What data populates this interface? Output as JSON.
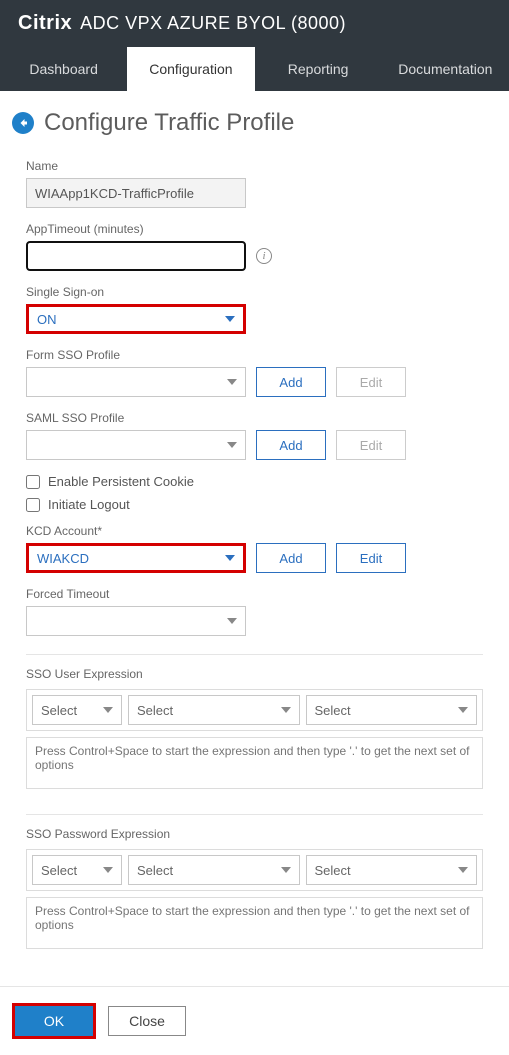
{
  "header": {
    "brand": "Citrix",
    "product": "ADC VPX AZURE BYOL (8000)"
  },
  "tabs": [
    "Dashboard",
    "Configuration",
    "Reporting",
    "Documentation"
  ],
  "active_tab_index": 1,
  "page": {
    "title": "Configure Traffic Profile"
  },
  "form": {
    "name": {
      "label": "Name",
      "value": "WIAApp1KCD-TrafficProfile"
    },
    "app_timeout": {
      "label": "AppTimeout (minutes)",
      "value": ""
    },
    "sso": {
      "label": "Single Sign-on",
      "value": "ON"
    },
    "form_sso": {
      "label": "Form SSO Profile",
      "value": "",
      "add": "Add",
      "edit": "Edit"
    },
    "saml_sso": {
      "label": "SAML SSO Profile",
      "value": "",
      "add": "Add",
      "edit": "Edit"
    },
    "persistent_cookie": {
      "label": "Enable Persistent Cookie",
      "checked": false
    },
    "initiate_logout": {
      "label": "Initiate Logout",
      "checked": false
    },
    "kcd": {
      "label": "KCD Account*",
      "value": "WIAKCD",
      "add": "Add",
      "edit": "Edit"
    },
    "forced_timeout": {
      "label": "Forced Timeout",
      "value": ""
    },
    "sso_user_expr": {
      "label": "SSO User Expression",
      "select_placeholder": "Select",
      "hint": "Press Control+Space to start the expression and then type '.' to get the next set of options"
    },
    "sso_pwd_expr": {
      "label": "SSO Password Expression",
      "select_placeholder": "Select",
      "hint": "Press Control+Space to start the expression and then type '.' to get the next set of options"
    }
  },
  "footer": {
    "ok": "OK",
    "close": "Close"
  }
}
